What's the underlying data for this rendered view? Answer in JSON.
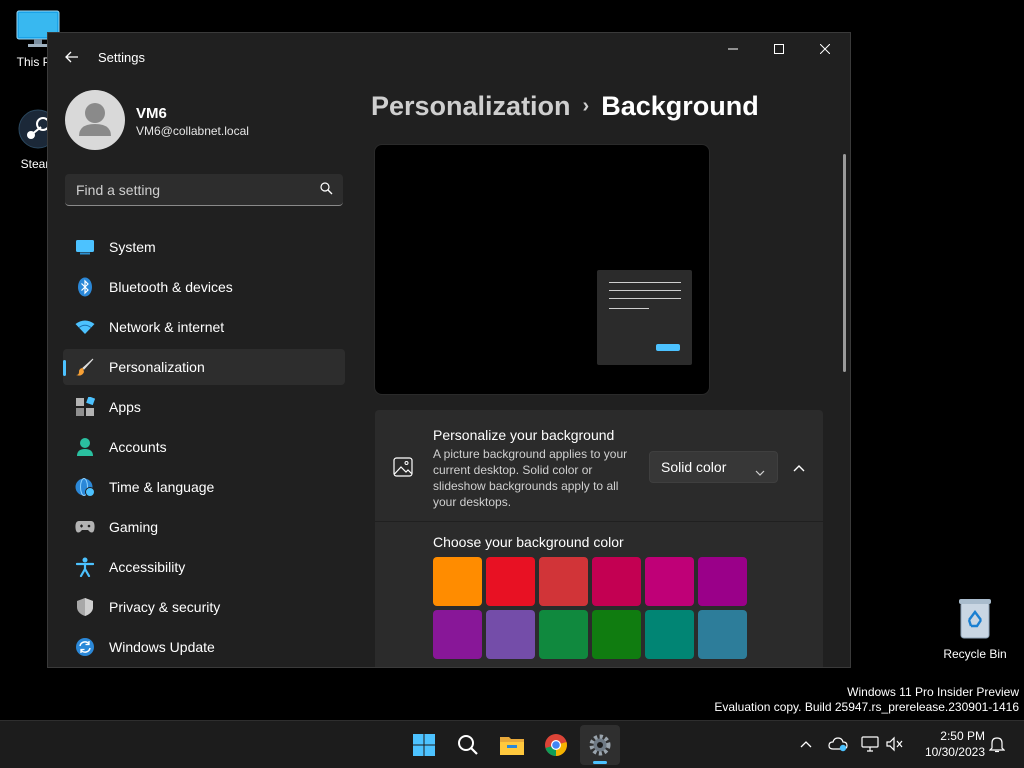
{
  "desktop": {
    "icons": [
      {
        "label": "This PC"
      },
      {
        "label": "Steam"
      },
      {
        "label": "Recycle Bin"
      }
    ]
  },
  "window": {
    "title": "Settings",
    "user": {
      "name": "VM6",
      "email": "VM6@collabnet.local"
    },
    "search": {
      "placeholder": "Find a setting"
    },
    "nav": [
      {
        "label": "System",
        "icon": "system-icon"
      },
      {
        "label": "Bluetooth & devices",
        "icon": "bluetooth-icon"
      },
      {
        "label": "Network & internet",
        "icon": "wifi-icon"
      },
      {
        "label": "Personalization",
        "icon": "brush-icon",
        "active": true
      },
      {
        "label": "Apps",
        "icon": "apps-icon"
      },
      {
        "label": "Accounts",
        "icon": "accounts-icon"
      },
      {
        "label": "Time & language",
        "icon": "globe-clock-icon"
      },
      {
        "label": "Gaming",
        "icon": "gamepad-icon"
      },
      {
        "label": "Accessibility",
        "icon": "accessibility-icon"
      },
      {
        "label": "Privacy & security",
        "icon": "shield-icon"
      },
      {
        "label": "Windows Update",
        "icon": "update-icon"
      }
    ]
  },
  "main": {
    "breadcrumb": {
      "parent": "Personalization",
      "separator": "›",
      "current": "Background"
    },
    "background_card": {
      "title": "Personalize your background",
      "description": "A picture background applies to your current desktop. Solid color or slideshow backgrounds apply to all your desktops.",
      "dropdown_value": "Solid color"
    },
    "color_section": {
      "title": "Choose your background color",
      "swatches": [
        "#ff8c00",
        "#e81123",
        "#d13438",
        "#c30052",
        "#bf0077",
        "#9a0089",
        "#881798",
        "#744da9",
        "#10893e",
        "#107c10",
        "#018574",
        "#2d7d9a"
      ]
    }
  },
  "watermark": {
    "line1": "Windows 11 Pro Insider Preview",
    "line2": "Evaluation copy. Build 25947.rs_prerelease.230901-1416"
  },
  "taskbar": {
    "time": "2:50 PM",
    "date": "10/30/2023",
    "accent": "#4cc2ff"
  }
}
